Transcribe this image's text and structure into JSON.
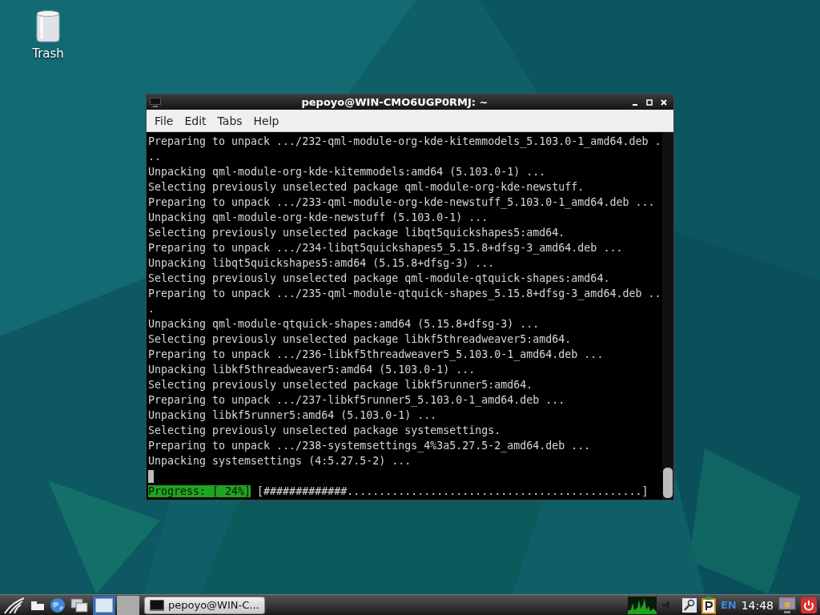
{
  "desktop_icons": [
    {
      "label": "Trash"
    }
  ],
  "window": {
    "title": "pepoyo@WIN-CMO6UGP0RMJ: ~",
    "menu": [
      "File",
      "Edit",
      "Tabs",
      "Help"
    ],
    "terminal": {
      "lines": [
        "Preparing to unpack .../232-qml-module-org-kde-kitemmodels_5.103.0-1_amd64.deb .",
        "..",
        "Unpacking qml-module-org-kde-kitemmodels:amd64 (5.103.0-1) ...",
        "Selecting previously unselected package qml-module-org-kde-newstuff.",
        "Preparing to unpack .../233-qml-module-org-kde-newstuff_5.103.0-1_amd64.deb ...",
        "Unpacking qml-module-org-kde-newstuff (5.103.0-1) ...",
        "Selecting previously unselected package libqt5quickshapes5:amd64.",
        "Preparing to unpack .../234-libqt5quickshapes5_5.15.8+dfsg-3_amd64.deb ...",
        "Unpacking libqt5quickshapes5:amd64 (5.15.8+dfsg-3) ...",
        "Selecting previously unselected package qml-module-qtquick-shapes:amd64.",
        "Preparing to unpack .../235-qml-module-qtquick-shapes_5.15.8+dfsg-3_amd64.deb ..",
        ".",
        "Unpacking qml-module-qtquick-shapes:amd64 (5.15.8+dfsg-3) ...",
        "Selecting previously unselected package libkf5threadweaver5:amd64.",
        "Preparing to unpack .../236-libkf5threadweaver5_5.103.0-1_amd64.deb ...",
        "Unpacking libkf5threadweaver5:amd64 (5.103.0-1) ...",
        "Selecting previously unselected package libkf5runner5:amd64.",
        "Preparing to unpack .../237-libkf5runner5_5.103.0-1_amd64.deb ...",
        "Unpacking libkf5runner5:amd64 (5.103.0-1) ...",
        "Selecting previously unselected package systemsettings.",
        "Preparing to unpack .../238-systemsettings_4%3a5.27.5-2_amd64.deb ...",
        "Unpacking systemsettings (4:5.27.5-2) ..."
      ],
      "progress_label": "Progress: [ 24%]",
      "progress_bar": "[#############..............................................]"
    }
  },
  "taskbar": {
    "workspaces": [
      {
        "selected": true
      },
      {
        "selected": false
      }
    ],
    "tasks": [
      {
        "label": "pepoyo@WIN-C...",
        "selected": false
      }
    ],
    "keyboard_layout": "EN",
    "clock": "14:48"
  }
}
